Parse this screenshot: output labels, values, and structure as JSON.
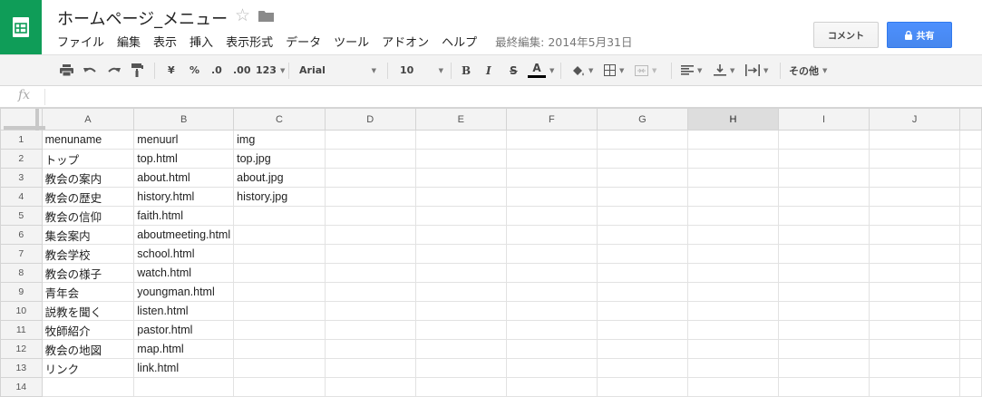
{
  "app": {
    "title": "ホームページ_メニュー",
    "last_edit": "最終編集: 2014年5月31日",
    "comment_label": "コメント",
    "share_label": "共有"
  },
  "menu": {
    "items": [
      "ファイル",
      "編集",
      "表示",
      "挿入",
      "表示形式",
      "データ",
      "ツール",
      "アドオン",
      "ヘルプ"
    ]
  },
  "toolbar": {
    "currency": "¥",
    "percent": "%",
    "dec_less": ".0",
    "dec_more": ".00",
    "format_more": "123",
    "font": "Arial",
    "font_size": "10",
    "bold": "B",
    "italic": "I",
    "strike": "S",
    "text_color": "A",
    "more": "その他"
  },
  "formula": {
    "label": "fx",
    "value": ""
  },
  "sheet": {
    "columns": [
      "A",
      "B",
      "C",
      "D",
      "E",
      "F",
      "G",
      "H",
      "I",
      "J"
    ],
    "active_column": "H",
    "rows": [
      {
        "num": "1",
        "cells": [
          "menuname",
          "menuurl",
          "img"
        ]
      },
      {
        "num": "2",
        "cells": [
          "トップ",
          "top.html",
          "top.jpg"
        ]
      },
      {
        "num": "3",
        "cells": [
          "教会の案内",
          "about.html",
          "about.jpg"
        ]
      },
      {
        "num": "4",
        "cells": [
          "教会の歴史",
          "history.html",
          "history.jpg"
        ]
      },
      {
        "num": "5",
        "cells": [
          "教会の信仰",
          "faith.html",
          ""
        ]
      },
      {
        "num": "6",
        "cells": [
          "集会案内",
          "aboutmeeting.html",
          ""
        ]
      },
      {
        "num": "7",
        "cells": [
          "教会学校",
          "school.html",
          ""
        ]
      },
      {
        "num": "8",
        "cells": [
          "教会の様子",
          "watch.html",
          ""
        ]
      },
      {
        "num": "9",
        "cells": [
          "青年会",
          "youngman.html",
          ""
        ]
      },
      {
        "num": "10",
        "cells": [
          "説教を聞く",
          "listen.html",
          ""
        ]
      },
      {
        "num": "11",
        "cells": [
          "牧師紹介",
          "pastor.html",
          ""
        ]
      },
      {
        "num": "12",
        "cells": [
          "教会の地図",
          "map.html",
          ""
        ]
      },
      {
        "num": "13",
        "cells": [
          "リンク",
          "link.html",
          ""
        ]
      },
      {
        "num": "14",
        "cells": [
          "",
          "",
          ""
        ]
      }
    ]
  },
  "colors": {
    "brand": "#0f9d58",
    "share": "#4d90fe",
    "active_header": "#dddddd"
  }
}
